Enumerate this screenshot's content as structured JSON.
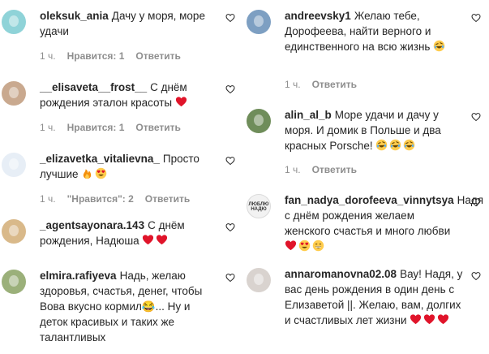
{
  "left": [
    {
      "user": "oleksuk_ania",
      "text": "Дачу у моря, море удачи",
      "emojis": [],
      "time": "1 ч.",
      "likes": "Нравится: 1",
      "reply": "Ответить",
      "avatar_color": "#8fd3d8"
    },
    {
      "user": "__elisaveta__frost__",
      "text": "С днём рождения эталон красоты",
      "emojis": [
        "red-heart"
      ],
      "time": "1 ч.",
      "likes": "Нравится: 1",
      "reply": "Ответить",
      "avatar_color": "#c9a98f"
    },
    {
      "user": "_elizavetka_vitalievna_",
      "text": "Просто лучшие",
      "emojis": [
        "fire",
        "heart-eyes"
      ],
      "time": "1 ч.",
      "likes": "\"Нравится\": 2",
      "reply": "Ответить",
      "avatar_color": "#e7eef6"
    },
    {
      "user": "_agentsayonara.143",
      "text": "С днём рождения, Надюша",
      "emojis": [
        "red-heart",
        "red-heart"
      ],
      "time": "",
      "likes": "",
      "reply": "",
      "avatar_color": "#d9b98a"
    },
    {
      "user": "elmira.rafiyeva",
      "text": "Надь, желаю здоровья, счастья, денег, чтобы Вова вкусно кормил😂... Ну и деток красивых и таких же талантливых",
      "emojis": [],
      "time": "",
      "likes": "",
      "reply": "",
      "avatar_color": "#9bb07a"
    }
  ],
  "right": [
    {
      "user": "andreevsky1",
      "text": "Желаю тебе, Дорофеева, найти верного и единственного на всю жизнь",
      "emojis": [
        "rofl"
      ],
      "time": "1 ч.",
      "likes": "",
      "reply": "Ответить",
      "avatar_color": "#7d9fc2"
    },
    {
      "user": "alin_al_b",
      "text": "Море удачи и дачу у моря. И домик в Польше и два красных Porsche!",
      "emojis": [
        "rofl",
        "rofl",
        "rofl"
      ],
      "time": "1 ч.",
      "likes": "",
      "reply": "Ответить",
      "avatar_color": "#6f8d5a"
    },
    {
      "user": "fan_nadya_dorofeeva_vinnytsya",
      "text": "Надя с днём рождения желаем женского счастья и много любви",
      "emojis": [
        "red-heart",
        "heart-eyes",
        "grin"
      ],
      "time": "",
      "likes": "",
      "reply": "",
      "avatar_color": "#f2f2f2",
      "avatar_text": "ЛЮБЛЮ НАДЮ"
    },
    {
      "user": "annaromanovna02.08",
      "text": "Вау! Надя, у вас день рождения в один день с Елизаветой ||. Желаю, вам, долгих и счастливых лет жизни",
      "emojis": [
        "red-heart",
        "red-heart",
        "red-heart"
      ],
      "time": "",
      "likes": "",
      "reply": "",
      "avatar_color": "#d9d3cf"
    }
  ]
}
